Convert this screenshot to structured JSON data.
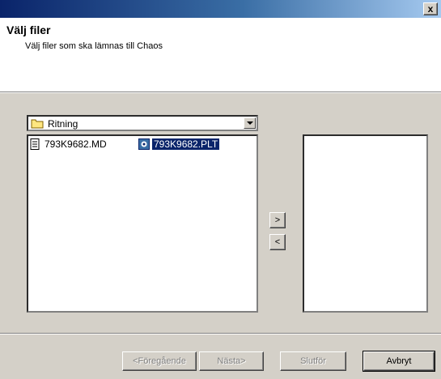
{
  "window": {
    "close_label": "x"
  },
  "header": {
    "title": "Välj filer",
    "subtitle": "Välj filer som ska lämnas till Chaos"
  },
  "folder_combo": {
    "value": "Ritning",
    "icon": "folder-icon"
  },
  "files": [
    {
      "name": "793K9682.MD",
      "icon": "document-icon",
      "selected": false
    },
    {
      "name": "793K9682.PLT",
      "icon": "plot-file-icon",
      "selected": true
    }
  ],
  "transfer": {
    "add_label": ">",
    "remove_label": "<"
  },
  "footer": {
    "back_label": "<Föregående",
    "next_label": "Nästa>",
    "finish_label": "Slutför",
    "cancel_label": "Avbryt"
  }
}
